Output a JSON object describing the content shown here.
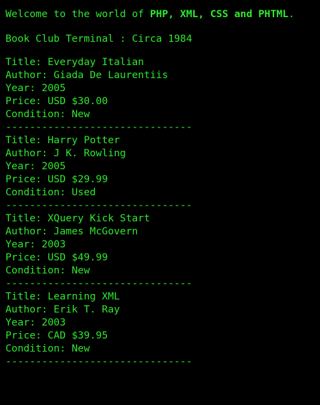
{
  "colors": {
    "background": "#000000",
    "text": "#2ee82e"
  },
  "header": {
    "welcome_prefix": "Welcome to the world of ",
    "welcome_highlight": "PHP, XML, CSS and PHTML",
    "welcome_suffix": ".",
    "subtitle": "Book Club Terminal : Circa 1984"
  },
  "books": [
    {
      "title": "Title: Everyday Italian",
      "author": "Author: Giada De Laurentiis",
      "year": "Year: 2005",
      "price": "Price: USD $30.00",
      "condition": "Condition: New",
      "divider": "-------------------------------"
    },
    {
      "title": "Title: Harry Potter",
      "author": "Author: J K. Rowling",
      "year": "Year: 2005",
      "price": "Price: USD $29.99",
      "condition": "Condition: Used",
      "divider": "-------------------------------"
    },
    {
      "title": "Title: XQuery Kick Start",
      "author": "Author: James McGovern",
      "year": "Year: 2003",
      "price": "Price: USD $49.99",
      "condition": "Condition: New",
      "divider": "-------------------------------"
    },
    {
      "title": "Title: Learning XML",
      "author": "Author: Erik T. Ray",
      "year": "Year: 2003",
      "price": "Price: CAD $39.95",
      "condition": "Condition: New",
      "divider": "-------------------------------"
    }
  ]
}
